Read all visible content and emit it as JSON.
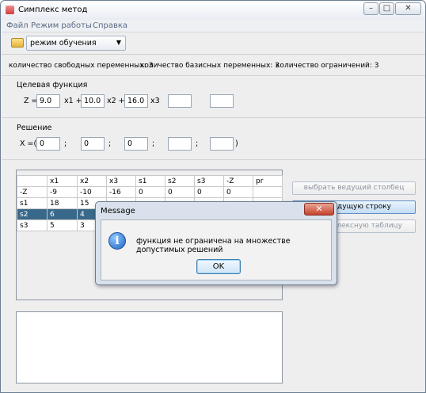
{
  "window": {
    "title": "Симплекс метод",
    "minimize": "–",
    "maximize": "□",
    "close": "✕"
  },
  "menu": [
    "Файл",
    "Режим работы",
    "Справка"
  ],
  "toolbar": {
    "folder_icon": "folder-open-icon",
    "mode_value": "режим обучения",
    "arrow": "▼"
  },
  "info": {
    "free_vars": "количество свободных переменных: 3",
    "basic_vars": "количество базисных переменных:  3",
    "constraints": "количество ограничений:  3"
  },
  "objective": {
    "label": "Целевая функция",
    "z_label": "Z =",
    "c1": "9.0",
    "x1": "x1 +",
    "c2": "10.0",
    "x2": "x2 +",
    "c3": "16.0",
    "x3": "x3",
    "c4": "",
    "c5": ""
  },
  "solution": {
    "label": "Решение",
    "x_label": "X =(",
    "v1": "0",
    "v2": "0",
    "v3": "0",
    "v4": "",
    "v5": "",
    "sep": ";",
    "close": ")"
  },
  "table": {
    "headers": [
      "",
      "x1",
      "x2",
      "x3",
      "s1",
      "s2",
      "s3",
      "-Z",
      "pr"
    ],
    "rows": [
      [
        "-Z",
        "-9",
        "-10",
        "-16",
        "0",
        "0",
        "0",
        "0",
        ""
      ],
      [
        "s1",
        "18",
        "15",
        "",
        "",
        "",
        "",
        "",
        ""
      ],
      [
        "s2",
        "6",
        "4",
        "",
        "",
        "",
        "",
        "",
        ""
      ],
      [
        "s3",
        "5",
        "3",
        "",
        "",
        "",
        "",
        "",
        ""
      ]
    ]
  },
  "buttons": {
    "choose_column": "выбрать ведущий столбец",
    "choose_row": "ведущую строку",
    "table": "симплексную таблицу"
  },
  "dialog": {
    "title": "Message",
    "close": "✕",
    "icon": "info-icon",
    "icon_glyph": "i",
    "message": "функция не ограничена на множестве допустимых решений",
    "ok": "OK"
  }
}
